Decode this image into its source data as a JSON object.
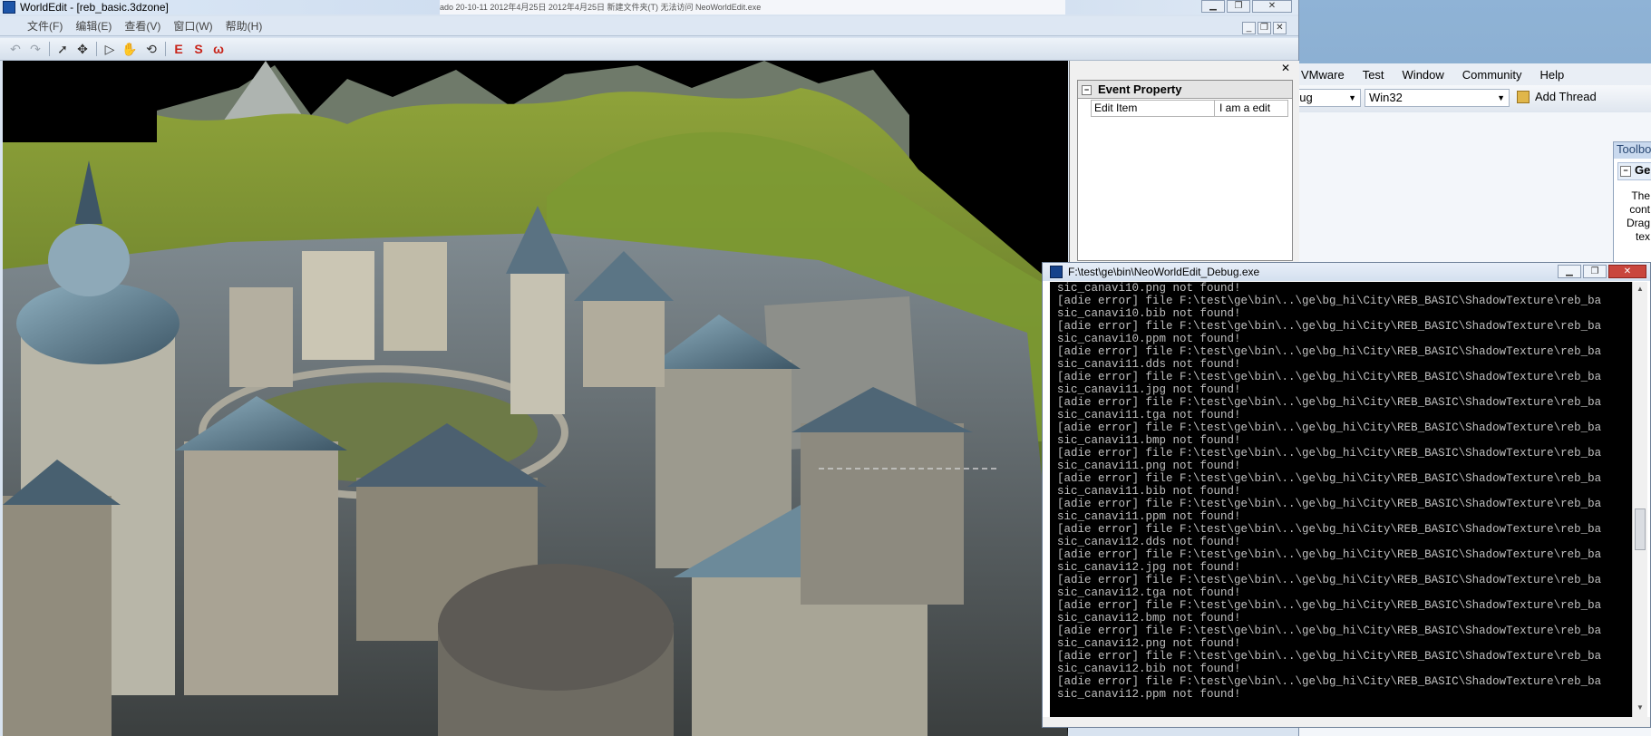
{
  "worldedit": {
    "title": "WorldEdit - [reb_basic.3dzone]",
    "menu": [
      "文件(F)",
      "编辑(E)",
      "查看(V)",
      "窗口(W)",
      "帮助(H)"
    ],
    "taskstrip_text": "ado   20-10-11 2012年4月25日    2012年4月25日   新建文件夹(T) 无法访问 NeoWorldEdit.exe"
  },
  "event_property": {
    "header": "Event Property",
    "row_name": "Edit Item",
    "row_value": "I am a edit"
  },
  "console": {
    "title": "F:\\test\\ge\\bin\\NeoWorldEdit_Debug.exe",
    "lines": [
      "sic_canavi10.png not found!",
      "[adie error] file F:\\test\\ge\\bin\\..\\ge\\bg_hi\\City\\REB_BASIC\\ShadowTexture\\reb_ba",
      "sic_canavi10.bib not found!",
      "[adie error] file F:\\test\\ge\\bin\\..\\ge\\bg_hi\\City\\REB_BASIC\\ShadowTexture\\reb_ba",
      "sic_canavi10.ppm not found!",
      "[adie error] file F:\\test\\ge\\bin\\..\\ge\\bg_hi\\City\\REB_BASIC\\ShadowTexture\\reb_ba",
      "sic_canavi11.dds not found!",
      "[adie error] file F:\\test\\ge\\bin\\..\\ge\\bg_hi\\City\\REB_BASIC\\ShadowTexture\\reb_ba",
      "sic_canavi11.jpg not found!",
      "[adie error] file F:\\test\\ge\\bin\\..\\ge\\bg_hi\\City\\REB_BASIC\\ShadowTexture\\reb_ba",
      "sic_canavi11.tga not found!",
      "[adie error] file F:\\test\\ge\\bin\\..\\ge\\bg_hi\\City\\REB_BASIC\\ShadowTexture\\reb_ba",
      "sic_canavi11.bmp not found!",
      "[adie error] file F:\\test\\ge\\bin\\..\\ge\\bg_hi\\City\\REB_BASIC\\ShadowTexture\\reb_ba",
      "sic_canavi11.png not found!",
      "[adie error] file F:\\test\\ge\\bin\\..\\ge\\bg_hi\\City\\REB_BASIC\\ShadowTexture\\reb_ba",
      "sic_canavi11.bib not found!",
      "[adie error] file F:\\test\\ge\\bin\\..\\ge\\bg_hi\\City\\REB_BASIC\\ShadowTexture\\reb_ba",
      "sic_canavi11.ppm not found!",
      "[adie error] file F:\\test\\ge\\bin\\..\\ge\\bg_hi\\City\\REB_BASIC\\ShadowTexture\\reb_ba",
      "sic_canavi12.dds not found!",
      "[adie error] file F:\\test\\ge\\bin\\..\\ge\\bg_hi\\City\\REB_BASIC\\ShadowTexture\\reb_ba",
      "sic_canavi12.jpg not found!",
      "[adie error] file F:\\test\\ge\\bin\\..\\ge\\bg_hi\\City\\REB_BASIC\\ShadowTexture\\reb_ba",
      "sic_canavi12.tga not found!",
      "[adie error] file F:\\test\\ge\\bin\\..\\ge\\bg_hi\\City\\REB_BASIC\\ShadowTexture\\reb_ba",
      "sic_canavi12.bmp not found!",
      "[adie error] file F:\\test\\ge\\bin\\..\\ge\\bg_hi\\City\\REB_BASIC\\ShadowTexture\\reb_ba",
      "sic_canavi12.png not found!",
      "[adie error] file F:\\test\\ge\\bin\\..\\ge\\bg_hi\\City\\REB_BASIC\\ShadowTexture\\reb_ba",
      "sic_canavi12.bib not found!",
      "[adie error] file F:\\test\\ge\\bin\\..\\ge\\bg_hi\\City\\REB_BASIC\\ShadowTexture\\reb_ba",
      "sic_canavi12.ppm not found!"
    ]
  },
  "visual_studio": {
    "menu": [
      "VMware",
      "Test",
      "Window",
      "Community",
      "Help"
    ],
    "config_combo": "bug",
    "platform_combo": "Win32",
    "add_thread": "Add Thread",
    "toolbox_title": "Toolbo",
    "toolbox_group": "Gen",
    "toolbox_text": [
      "The",
      "cont",
      "Drag",
      "tex"
    ]
  },
  "colors": {
    "console_bg": "#000000",
    "console_text": "#c0c0c0",
    "close_button": "#c9463d"
  }
}
